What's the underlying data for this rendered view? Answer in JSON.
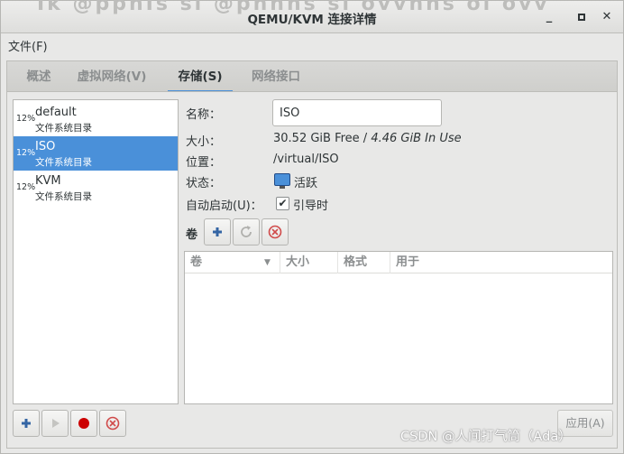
{
  "window": {
    "title": "QEMU/KVM 连接详情",
    "background_text": "Ik @ppnIs sl @pnnhs si ovvnhs ol ovv"
  },
  "menubar": {
    "file": "文件(F)"
  },
  "tabs": [
    {
      "label": "概述",
      "active": false
    },
    {
      "label": "虚拟网络(V)",
      "active": false
    },
    {
      "label": "存储(S)",
      "active": true
    },
    {
      "label": "网络接口",
      "active": false
    }
  ],
  "pools": [
    {
      "pct": "12%",
      "name": "default",
      "type": "文件系统目录",
      "selected": false
    },
    {
      "pct": "12%",
      "name": "ISO",
      "type": "文件系统目录",
      "selected": true
    },
    {
      "pct": "12%",
      "name": "KVM",
      "type": "文件系统目录",
      "selected": false
    }
  ],
  "details": {
    "name_label": "名称：",
    "name_value": "ISO",
    "size_label": "大小：",
    "size_free": "30.52 GiB Free",
    "size_sep": " / ",
    "size_use": "4.46 GiB In Use",
    "location_label": "位置：",
    "location_value": "/virtual/ISO",
    "state_label": "状态：",
    "state_value": "活跃",
    "autostart_label": "自动启动(U)：",
    "autostart_value": "引导时",
    "autostart_checked": true
  },
  "volumes": {
    "label": "卷",
    "columns": [
      "卷",
      "大小",
      "格式",
      "用于"
    ],
    "rows": []
  },
  "buttons": {
    "apply": "应用(A)"
  },
  "colors": {
    "accent": "#4a90d9",
    "record": "#cc0000",
    "delete": "#d04a4a"
  },
  "watermark": "CSDN @人间打气筒（Ada）"
}
